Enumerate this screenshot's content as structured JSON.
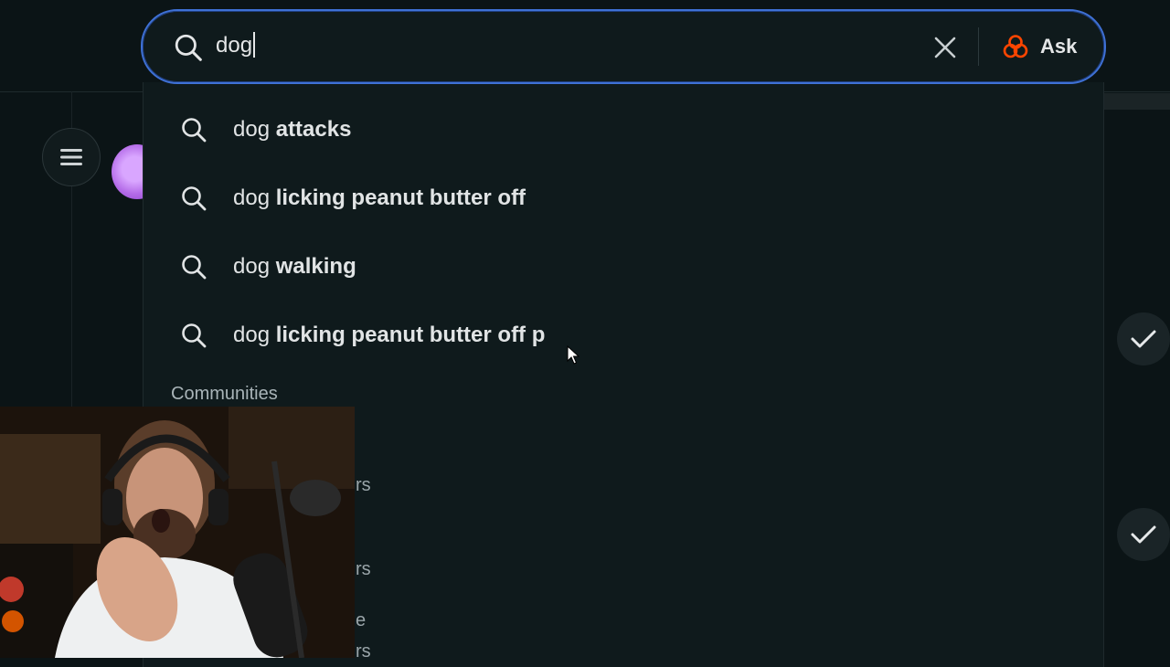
{
  "search": {
    "query": "dog",
    "ask_label": "Ask"
  },
  "suggestions": [
    {
      "typed": "dog",
      "completion": "attacks"
    },
    {
      "typed": "dog",
      "completion": "licking peanut butter off"
    },
    {
      "typed": "dog",
      "completion": "walking"
    },
    {
      "typed": "dog",
      "completion": "licking peanut butter off p"
    }
  ],
  "communities": {
    "heading": "Communities",
    "partial_items": [
      "rs",
      "rs",
      "e",
      "rs"
    ]
  },
  "icons": {
    "search": "search-icon",
    "clear": "close-icon",
    "ask": "reddit-answers-icon",
    "menu": "hamburger-menu-icon",
    "check": "checkmark-icon"
  },
  "colors": {
    "focus_ring": "#3f71d6",
    "ask_icon": "#ff4500",
    "background": "#0b1416"
  }
}
